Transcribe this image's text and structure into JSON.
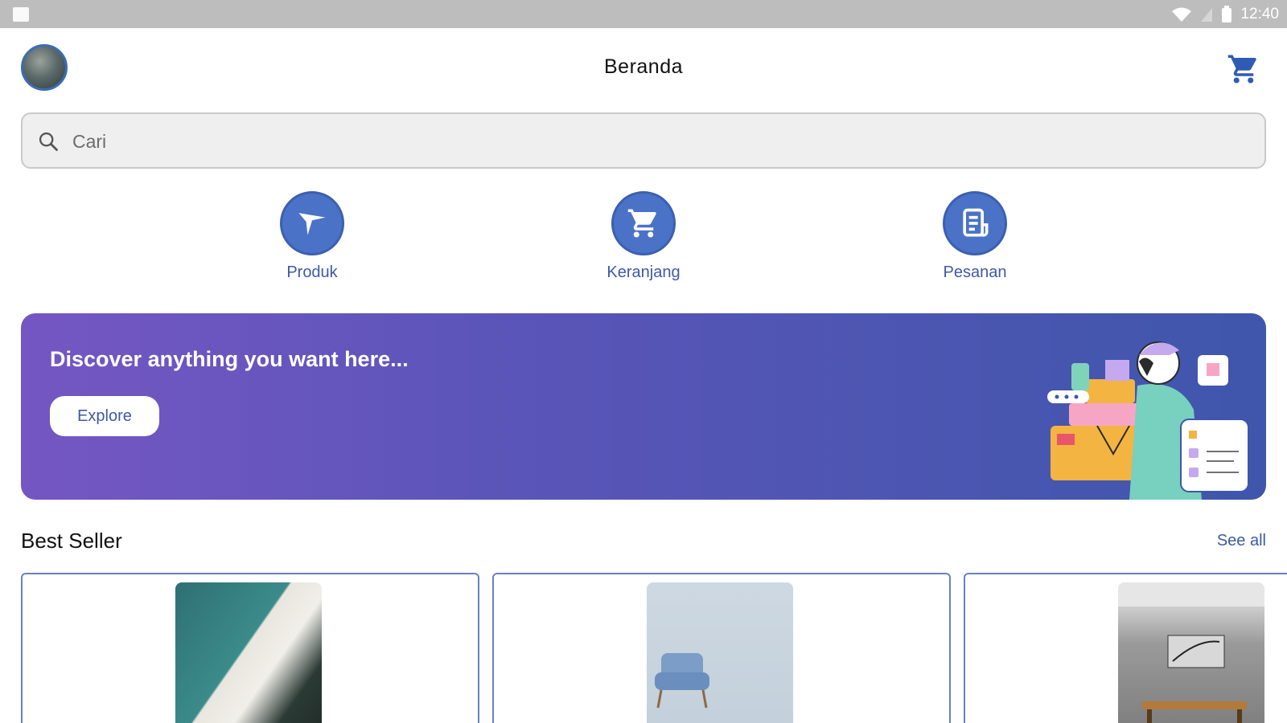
{
  "status_bar": {
    "time": "12:40"
  },
  "header": {
    "title": "Beranda"
  },
  "search": {
    "placeholder": "Cari"
  },
  "shortcuts": [
    {
      "label": "Produk",
      "icon": "send-icon"
    },
    {
      "label": "Keranjang",
      "icon": "cart-icon"
    },
    {
      "label": "Pesanan",
      "icon": "receipt-icon"
    }
  ],
  "banner": {
    "text": "Discover anything you want here...",
    "button_label": "Explore"
  },
  "best_seller": {
    "title": "Best Seller",
    "see_all_label": "See all"
  },
  "colors": {
    "accent": "#3d5aa8",
    "icon_circle": "#4a72c7",
    "banner_start": "#7556c3",
    "banner_end": "#3f56ac"
  }
}
